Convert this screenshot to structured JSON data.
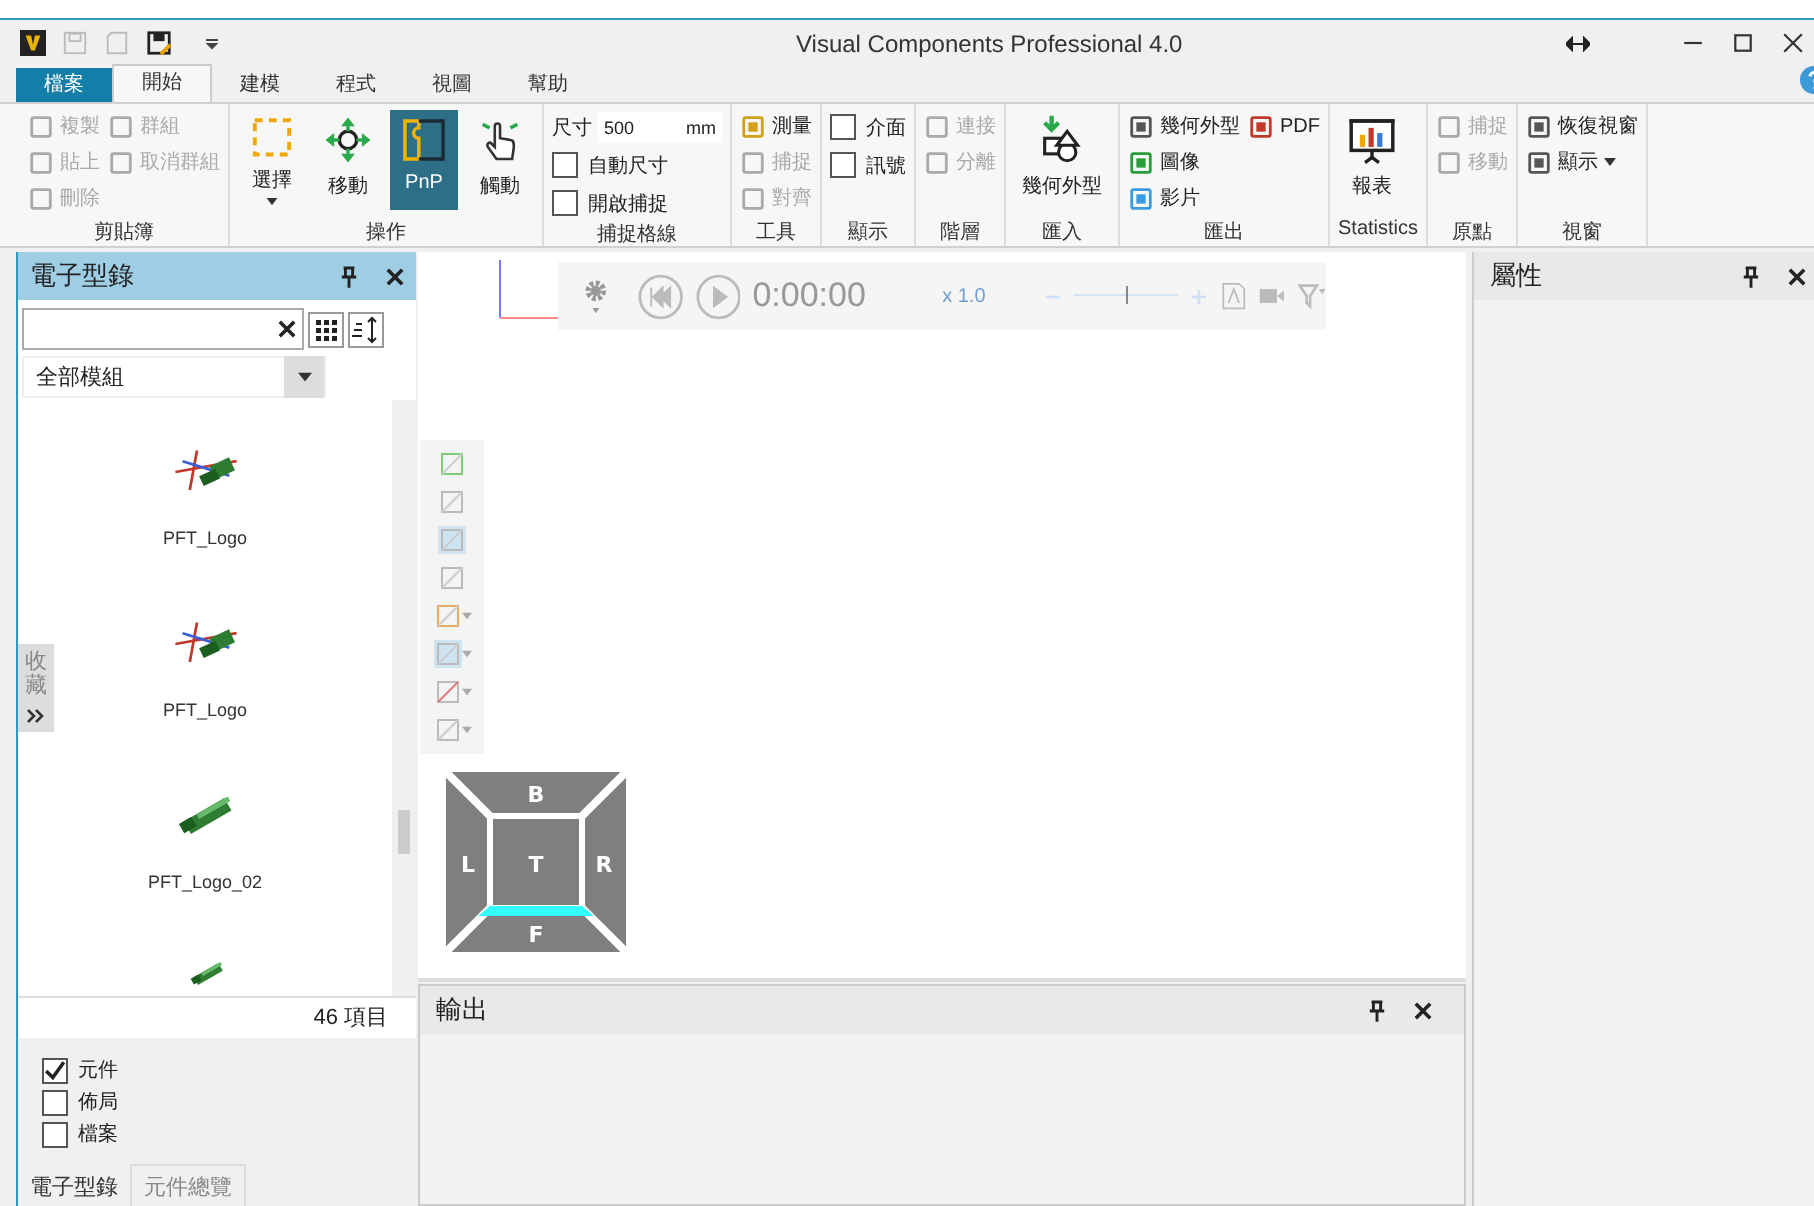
{
  "window": {
    "title": "Visual Components Professional 4.0"
  },
  "tabs": [
    {
      "label": "檔案",
      "kind": "file",
      "selected": false
    },
    {
      "label": "開始",
      "kind": "tab",
      "selected": true
    },
    {
      "label": "建模",
      "kind": "tab",
      "selected": false
    },
    {
      "label": "程式",
      "kind": "tab",
      "selected": false
    },
    {
      "label": "視圖",
      "kind": "tab",
      "selected": false
    },
    {
      "label": "幫助",
      "kind": "tab",
      "selected": false
    }
  ],
  "ribbon": [
    {
      "label": "剪貼簿",
      "columns": [
        {
          "items": [
            {
              "kind": "small",
              "label": "複製",
              "disabled": true,
              "dropdown": false
            },
            {
              "kind": "small",
              "label": "貼上",
              "disabled": true,
              "dropdown": false
            },
            {
              "kind": "small",
              "label": "刪除",
              "disabled": true,
              "dropdown": false
            }
          ]
        },
        {
          "items": [
            {
              "kind": "small",
              "label": "群組",
              "disabled": true,
              "dropdown": false
            },
            {
              "kind": "small",
              "label": "取消群組",
              "disabled": true,
              "dropdown": false
            }
          ]
        }
      ]
    },
    {
      "label": "操作",
      "columns": [
        {
          "items": [
            {
              "kind": "large",
              "label": "選擇",
              "disabled": false,
              "dropdown": true,
              "selected": false
            }
          ]
        },
        {
          "items": [
            {
              "kind": "large",
              "label": "移動",
              "disabled": false,
              "dropdown": false,
              "selected": false
            }
          ]
        },
        {
          "items": [
            {
              "kind": "large",
              "label": "PnP",
              "disabled": false,
              "dropdown": false,
              "selected": true
            }
          ]
        },
        {
          "items": [
            {
              "kind": "large",
              "label": "觸動",
              "disabled": false,
              "dropdown": false,
              "selected": false
            }
          ]
        }
      ]
    },
    {
      "label": "捕捉格線",
      "columns": [
        {
          "items": [
            {
              "kind": "field",
              "label": "尺寸",
              "value": "500",
              "unit": "mm"
            },
            {
              "kind": "checkbox",
              "label": "自動尺寸",
              "checked": false
            },
            {
              "kind": "checkbox",
              "label": "開啟捕捉",
              "checked": false
            }
          ]
        }
      ]
    },
    {
      "label": "工具",
      "columns": [
        {
          "items": [
            {
              "kind": "small",
              "label": "測量",
              "disabled": false,
              "dropdown": false
            },
            {
              "kind": "small",
              "label": "捕捉",
              "disabled": true,
              "dropdown": false
            },
            {
              "kind": "small",
              "label": "對齊",
              "disabled": true,
              "dropdown": false
            }
          ]
        }
      ]
    },
    {
      "label": "顯示",
      "columns": [
        {
          "items": [
            {
              "kind": "checkbox",
              "label": "介面",
              "checked": false
            },
            {
              "kind": "checkbox",
              "label": "訊號",
              "checked": false
            }
          ]
        }
      ]
    },
    {
      "label": "階層",
      "columns": [
        {
          "items": [
            {
              "kind": "small",
              "label": "連接",
              "disabled": true,
              "dropdown": false
            },
            {
              "kind": "small",
              "label": "分離",
              "disabled": true,
              "dropdown": false
            }
          ]
        }
      ]
    },
    {
      "label": "匯入",
      "columns": [
        {
          "items": [
            {
              "kind": "large",
              "label": "幾何外型",
              "disabled": false,
              "dropdown": false,
              "selected": false
            }
          ]
        }
      ]
    },
    {
      "label": "匯出",
      "columns": [
        {
          "items": [
            {
              "kind": "small",
              "label": "幾何外型",
              "disabled": false,
              "dropdown": false
            },
            {
              "kind": "small",
              "label": "圖像",
              "disabled": false,
              "dropdown": false
            },
            {
              "kind": "small",
              "label": "影片",
              "disabled": false,
              "dropdown": false
            }
          ]
        },
        {
          "items": [
            {
              "kind": "small",
              "label": "PDF",
              "disabled": false,
              "dropdown": false
            }
          ]
        }
      ]
    },
    {
      "label": "Statistics",
      "columns": [
        {
          "items": [
            {
              "kind": "large",
              "label": "報表",
              "disabled": false,
              "dropdown": false,
              "selected": false
            }
          ]
        }
      ]
    },
    {
      "label": "原點",
      "columns": [
        {
          "items": [
            {
              "kind": "small",
              "label": "捕捉",
              "disabled": true,
              "dropdown": false
            },
            {
              "kind": "small",
              "label": "移動",
              "disabled": true,
              "dropdown": false
            }
          ]
        }
      ]
    },
    {
      "label": "視窗",
      "columns": [
        {
          "items": [
            {
              "kind": "small",
              "label": "恢復視窗",
              "disabled": false,
              "dropdown": false
            },
            {
              "kind": "small",
              "label": "顯示",
              "disabled": false,
              "dropdown": true
            }
          ]
        }
      ]
    }
  ],
  "catalog": {
    "title": "電子型錄",
    "filter": "全部模組",
    "side_tab": "收藏",
    "items": [
      {
        "kind": "item",
        "label": "PFT_Logo"
      },
      {
        "kind": "item",
        "label": "PFT_Logo"
      },
      {
        "kind": "item",
        "label": "PFT_Logo_02"
      },
      {
        "kind": "picture"
      }
    ],
    "count": "46 項目",
    "types": [
      {
        "label": "元件",
        "checked": true
      },
      {
        "label": "佈局",
        "checked": false
      },
      {
        "label": "檔案",
        "checked": false
      }
    ],
    "bottom_tabs": [
      {
        "label": "電子型錄",
        "selected": true
      },
      {
        "label": "元件總覽",
        "selected": false
      }
    ]
  },
  "viewport": {
    "time": "0:00:00",
    "speed": "x 1.0",
    "zoom": {
      "level": 0.5
    },
    "view_tools": [
      {
        "selected": false,
        "dropdown": false
      },
      {
        "selected": false,
        "dropdown": false
      },
      {
        "selected": true,
        "dropdown": false
      },
      {
        "selected": false,
        "dropdown": false
      },
      {
        "selected": false,
        "dropdown": true
      },
      {
        "selected": true,
        "dropdown": true
      },
      {
        "selected": false,
        "dropdown": true
      },
      {
        "selected": false,
        "dropdown": true
      }
    ],
    "cube": {
      "top": "B",
      "left": "L",
      "center": "T",
      "right": "R",
      "bottom": "F"
    }
  },
  "output": {
    "title": "輸出"
  },
  "properties": {
    "title": "屬性"
  }
}
